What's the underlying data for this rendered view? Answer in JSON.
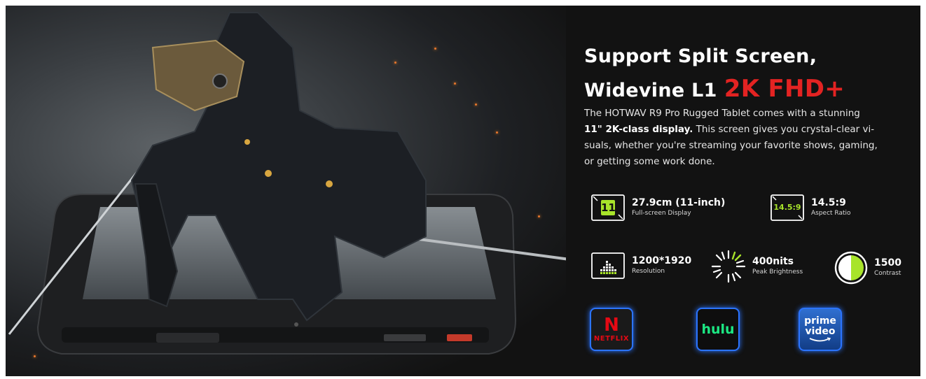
{
  "headline": {
    "line1": "Support Split Screen,",
    "line2_prefix": "Widevine L1",
    "line2_accent": "2K FHD+",
    "accent_color": "#e32322"
  },
  "description": {
    "part1": "The HOTWAV R9 Pro Rugged Tablet comes with a stunning",
    "bold": "11\" 2K-class display.",
    "part2": "This screen gives you crystal-clear vi-suals, whether you're streaming your favorite shows, gaming, or getting some work done."
  },
  "specs": {
    "size": {
      "icon": "screen-size-icon",
      "icon_text": "11",
      "value": "27.9cm (11-inch)",
      "caption": "Full-screen Display"
    },
    "ratio": {
      "icon": "aspect-ratio-icon",
      "icon_text": "14.5:9",
      "value": "14.5:9",
      "caption": "Aspect Ratio"
    },
    "resolution": {
      "icon": "resolution-icon",
      "value": "1200*1920",
      "caption": "Resolution"
    },
    "brightness": {
      "icon": "brightness-icon",
      "value": "400nits",
      "caption": "Peak Brightness"
    },
    "contrast": {
      "icon": "contrast-icon",
      "value": "1500",
      "caption": "Contrast"
    }
  },
  "services": {
    "netflix": {
      "icon_letter": "N",
      "label": "NETFLIX",
      "color": "#e50914"
    },
    "hulu": {
      "label": "hulu",
      "color": "#1ce783"
    },
    "prime": {
      "line1": "prime",
      "line2": "video",
      "color": "#ffffff"
    }
  },
  "colors": {
    "background": "#121212",
    "spec_green": "#a8e42a",
    "glow_blue": "#2b74ff"
  }
}
